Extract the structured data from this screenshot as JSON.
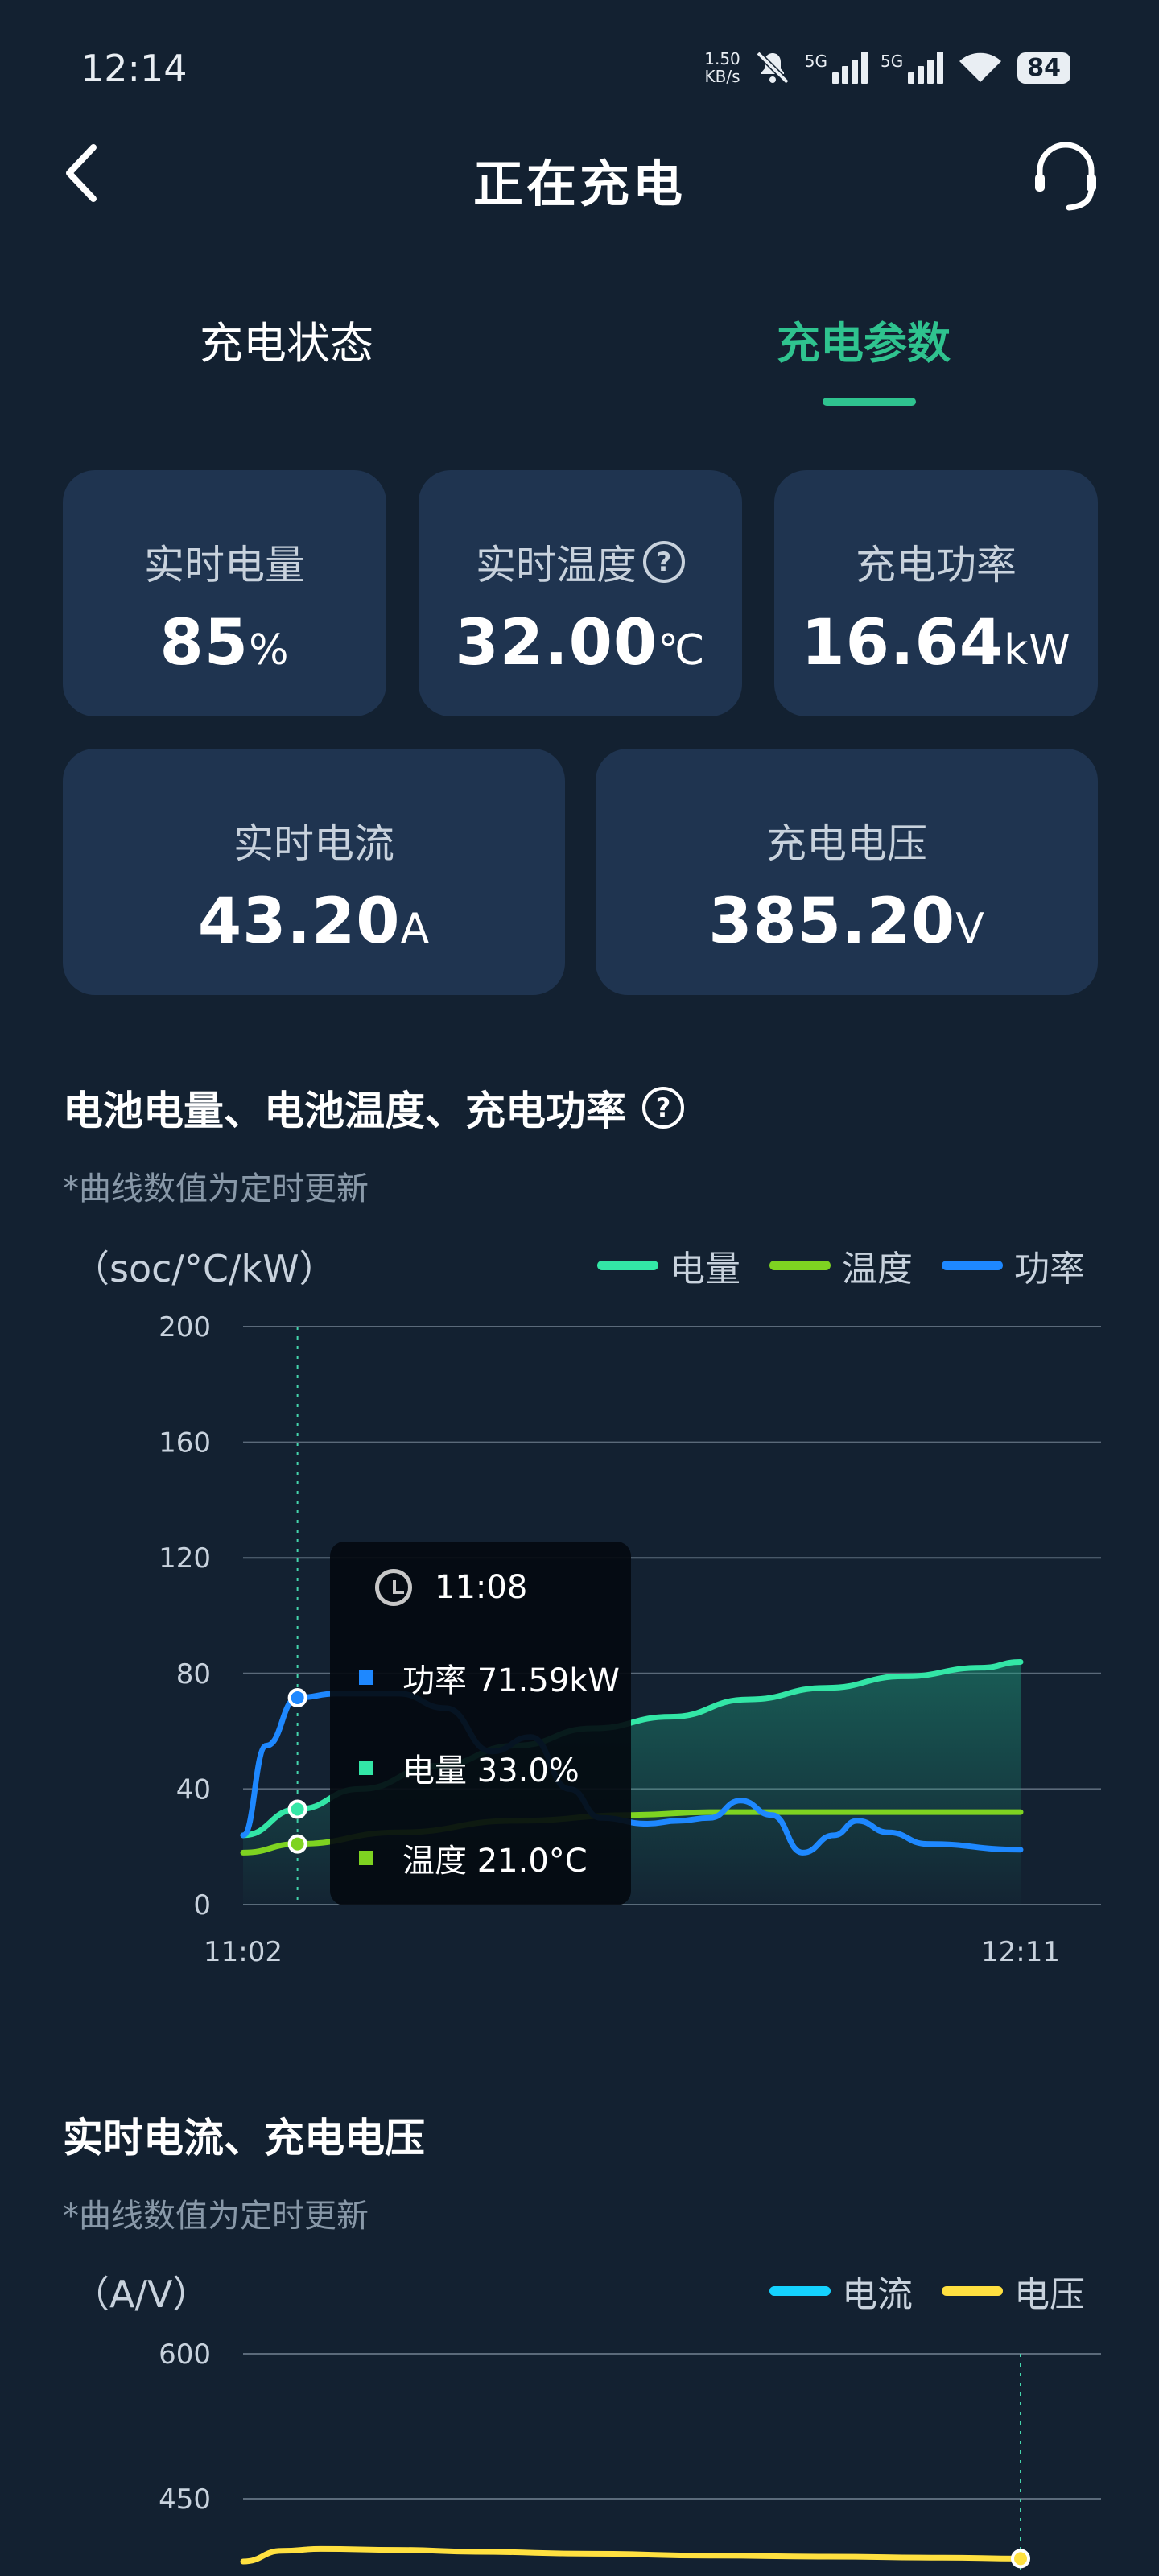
{
  "status_bar": {
    "time": "12:14",
    "net_speed_value": "1.50",
    "net_speed_unit": "KB/s",
    "sim1": "5G",
    "sim2": "5G",
    "battery": "84"
  },
  "header": {
    "title": "正在充电",
    "back_icon": "chevron-left-icon",
    "support_icon": "headset-icon"
  },
  "tabs": [
    {
      "label": "充电状态",
      "active": false
    },
    {
      "label": "充电参数",
      "active": true
    }
  ],
  "cards": {
    "soc": {
      "label": "实时电量",
      "value": "85",
      "unit": "%"
    },
    "temp": {
      "label": "实时温度",
      "value": "32.00",
      "unit": "℃",
      "help_icon": "help-circle-icon"
    },
    "power": {
      "label": "充电功率",
      "value": "16.64",
      "unit": "kW"
    },
    "current": {
      "label": "实时电流",
      "value": "43.20",
      "unit": "A"
    },
    "voltage": {
      "label": "充电电压",
      "value": "385.20",
      "unit": "V"
    }
  },
  "section1": {
    "title": "电池电量、电池温度、充电功率",
    "note": "*曲线数值为定时更新",
    "unit_label": "（soc/°C/kW）",
    "legend": [
      {
        "name": "电量",
        "color": "#33e6a6"
      },
      {
        "name": "温度",
        "color": "#7ed321"
      },
      {
        "name": "功率",
        "color": "#1e88ff"
      }
    ],
    "tooltip": {
      "time": "11:08",
      "rows": [
        {
          "label": "功率 71.59kW",
          "color": "#1e88ff"
        },
        {
          "label": "电量 33.0%",
          "color": "#33e6a6"
        },
        {
          "label": "温度 21.0°C",
          "color": "#7ed321"
        }
      ]
    }
  },
  "section2": {
    "title": "实时电流、充电电压",
    "note": "*曲线数值为定时更新",
    "unit_label": "（A/V）",
    "legend": [
      {
        "name": "电流",
        "color": "#14d2ff"
      },
      {
        "name": "电压",
        "color": "#ffe040"
      }
    ]
  },
  "chart_data": [
    {
      "type": "line",
      "ylim": [
        0,
        200
      ],
      "yticks": [
        "200",
        "160",
        "120",
        "80",
        "40",
        "0"
      ],
      "xtick_labels": [
        "11:02",
        "12:11"
      ],
      "series": [
        {
          "name": "功率",
          "color": "#1e88ff",
          "points": [
            [
              0,
              24
            ],
            [
              0.03,
              55
            ],
            [
              0.07,
              71.6
            ],
            [
              0.12,
              73
            ],
            [
              0.2,
              73
            ],
            [
              0.26,
              68
            ],
            [
              0.32,
              53
            ],
            [
              0.37,
              58
            ],
            [
              0.42,
              40
            ],
            [
              0.46,
              30
            ],
            [
              0.52,
              28
            ],
            [
              0.56,
              29
            ],
            [
              0.6,
              30
            ],
            [
              0.64,
              36
            ],
            [
              0.68,
              31
            ],
            [
              0.72,
              18
            ],
            [
              0.76,
              24
            ],
            [
              0.79,
              29
            ],
            [
              0.83,
              25
            ],
            [
              0.88,
              21
            ],
            [
              1,
              19
            ]
          ]
        },
        {
          "name": "电量",
          "color": "#33e6a6",
          "points": [
            [
              0,
              24
            ],
            [
              0.07,
              33
            ],
            [
              0.15,
              40
            ],
            [
              0.25,
              48
            ],
            [
              0.35,
              55
            ],
            [
              0.45,
              61
            ],
            [
              0.55,
              65
            ],
            [
              0.65,
              71
            ],
            [
              0.75,
              75
            ],
            [
              0.85,
              79
            ],
            [
              0.95,
              82
            ],
            [
              1,
              84
            ]
          ]
        },
        {
          "name": "温度",
          "color": "#7ed321",
          "points": [
            [
              0,
              18
            ],
            [
              0.07,
              21
            ],
            [
              0.2,
              25
            ],
            [
              0.35,
              29
            ],
            [
              0.5,
              31
            ],
            [
              0.6,
              32
            ],
            [
              0.75,
              32
            ],
            [
              1,
              32
            ]
          ]
        }
      ],
      "highlight_index_time": "11:08"
    },
    {
      "type": "line",
      "ylim": [
        0,
        600
      ],
      "yticks": [
        "600",
        "450"
      ],
      "series": [
        {
          "name": "电压",
          "color": "#ffe040",
          "points": [
            [
              0,
              385
            ],
            [
              0.05,
              396
            ],
            [
              0.1,
              398
            ],
            [
              0.2,
              397
            ],
            [
              0.3,
              395
            ],
            [
              0.45,
              393
            ],
            [
              0.6,
              391
            ],
            [
              0.75,
              390
            ],
            [
              0.9,
              389
            ],
            [
              1,
              388
            ]
          ]
        },
        {
          "name": "电流",
          "color": "#14d2ff",
          "points": []
        }
      ]
    }
  ]
}
